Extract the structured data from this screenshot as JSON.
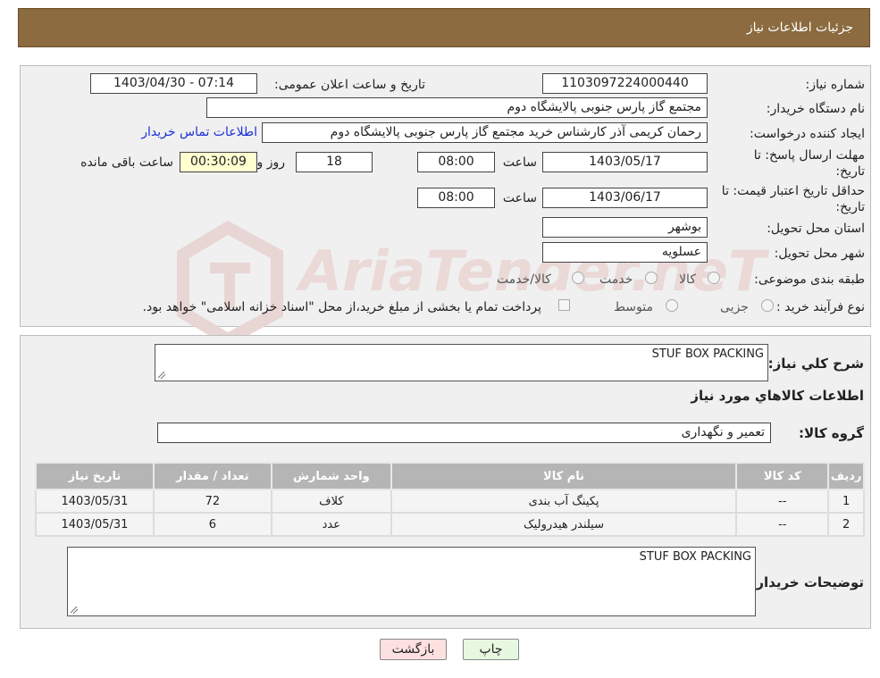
{
  "header": {
    "title": "جزئیات اطلاعات نیاز"
  },
  "form": {
    "need_number_label": "شماره نیاز:",
    "need_number": "1103097224000440",
    "announce_label": "تاریخ و ساعت اعلان عمومی:",
    "announce_value": "1403/04/30 - 07:14",
    "buyer_org_label": "نام دستگاه خریدار:",
    "buyer_org": "مجتمع گاز پارس جنوبی  پالایشگاه دوم",
    "creator_label": "ایجاد کننده درخواست:",
    "creator": "رحمان کریمی آذر کارشناس خرید مجتمع گاز پارس جنوبی  پالایشگاه دوم",
    "contact_link": "اطلاعات تماس خریدار",
    "deadline_label_1": "مهلت ارسال پاسخ: تا",
    "deadline_label_2": "تاریخ:",
    "deadline_date": "1403/05/17",
    "time_label": "ساعت",
    "deadline_time": "08:00",
    "days_value": "18",
    "days_label": "روز و",
    "remaining_time": "00:30:09",
    "remaining_label": "ساعت باقی مانده",
    "validity_label_1": "حداقل تاریخ اعتبار قیمت: تا",
    "validity_label_2": "تاریخ:",
    "validity_date": "1403/06/17",
    "validity_time": "08:00",
    "province_label": "استان محل تحویل:",
    "province": "بوشهر",
    "city_label": "شهر محل تحویل:",
    "city": "عسلویه",
    "category_label": "طبقه بندی موضوعی:",
    "category_options": [
      "کالا",
      "خدمت",
      "کالا/خدمت"
    ],
    "process_label": "نوع فرآیند خرید :",
    "process_options": [
      "جزیی",
      "متوسط"
    ],
    "payment_note": "پرداخت تمام یا بخشی از مبلغ خرید،از محل \"اسناد خزانه اسلامی\" خواهد بود."
  },
  "details": {
    "summary_label": "شرح کلي نياز:",
    "summary": "STUF BOX PACKING",
    "goods_info_title": "اطلاعات کالاهاي مورد نياز",
    "goods_group_label": "گروه کالا:",
    "goods_group": "تعمیر و نگهداری",
    "table": {
      "headers": [
        "ردیف",
        "کد کالا",
        "نام کالا",
        "واحد شمارش",
        "تعداد / مقدار",
        "تاریخ نیاز"
      ],
      "rows": [
        [
          "1",
          "--",
          "پکینگ آب بندی",
          "کلاف",
          "72",
          "1403/05/31"
        ],
        [
          "2",
          "--",
          "سیلندر هیدرولیک",
          "عدد",
          "6",
          "1403/05/31"
        ]
      ]
    },
    "buyer_notes_label": "توضیحات خریدار:",
    "buyer_notes": "STUF BOX PACKING"
  },
  "buttons": {
    "print": "چاپ",
    "back": "بازگشت"
  },
  "watermark": {
    "text": "AriaTender.neT"
  },
  "colors": {
    "header_bg": "#8b6b3f",
    "link": "#1a2fd6",
    "remaining_bg": "#ffffd0",
    "back_bg": "#fde0e0",
    "print_bg": "#e8f8e0"
  }
}
